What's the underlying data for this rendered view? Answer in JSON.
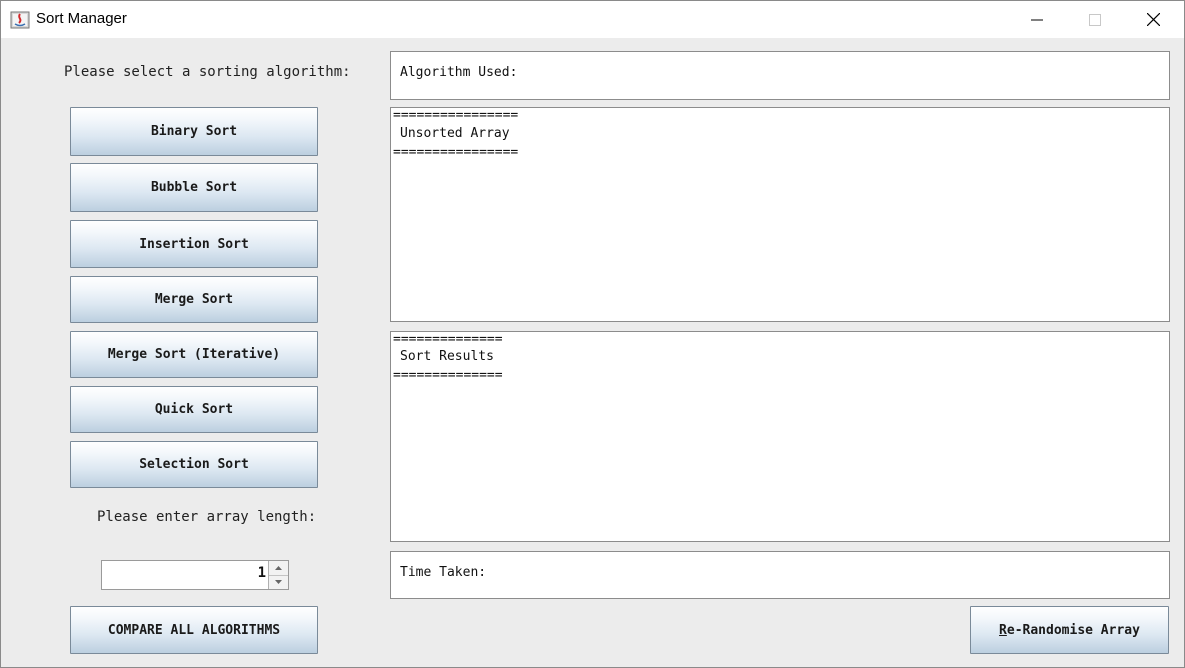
{
  "window": {
    "title": "Sort Manager",
    "app_icon": "java-icon",
    "controls": [
      "minimize-icon",
      "maximize-icon",
      "close-icon"
    ]
  },
  "left_panel": {
    "select_prompt": "Please select a sorting algorithm:",
    "buttons": [
      "Binary Sort",
      "Bubble Sort",
      "Insertion Sort",
      "Merge Sort",
      "Merge Sort (Iterative)",
      "Quick Sort",
      "Selection Sort"
    ],
    "length_prompt": "Please enter array length:",
    "array_length": "1",
    "compare_button": "COMPARE ALL ALGORITHMS"
  },
  "right_panel": {
    "algorithm_label": "Algorithm Used:",
    "unsorted": {
      "rule_top": "================",
      "heading": "Unsorted Array",
      "rule_bottom": "================"
    },
    "results": {
      "rule_top": "==============",
      "heading": "Sort Results",
      "rule_bottom": "=============="
    },
    "time_label": "Time Taken:",
    "randomise_button": {
      "mnemonic": "R",
      "rest": "e-Randomise Array"
    }
  },
  "colors": {
    "button_gradient_top": "#ffffff",
    "button_gradient_bottom": "#bccfe0",
    "window_bg": "#ececec"
  }
}
